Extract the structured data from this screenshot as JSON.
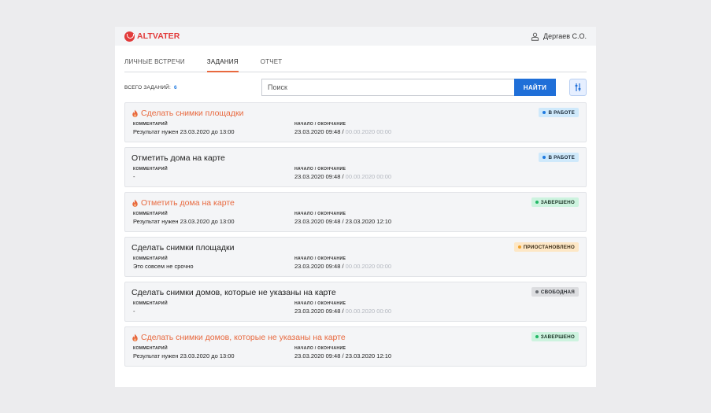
{
  "header": {
    "logo_text": "ALTVATER",
    "user_name": "Дергаев С.О."
  },
  "tabs": [
    {
      "label": "ЛИЧНЫЕ ВСТРЕЧИ",
      "active": false
    },
    {
      "label": "ЗАДАНИЯ",
      "active": true
    },
    {
      "label": "ОТЧЕТ",
      "active": false
    }
  ],
  "toolbar": {
    "total_label": "ВСЕГО ЗАДАНИЙ:",
    "total_count": "6",
    "search_placeholder": "Поиск",
    "search_button": "НАЙТИ"
  },
  "labels": {
    "comment": "КОММЕНТАРИЙ",
    "period": "НАЧАЛО / ОКОНЧАНИЕ"
  },
  "colors": {
    "accent": "#e8693f",
    "primary": "#1f6fd8",
    "brand": "#e23b3b"
  },
  "tasks": [
    {
      "title": "Сделать снимки площадки",
      "urgent": true,
      "status": "В РАБОТЕ",
      "status_kind": "work",
      "comment": "Результат нужен 23.03.2020 до 13:00",
      "start": "23.03.2020 09:48",
      "sep": " / ",
      "end": "00.00.2020 00:00",
      "end_set": false
    },
    {
      "title": "Отметить дома на карте",
      "urgent": false,
      "status": "В РАБОТЕ",
      "status_kind": "work",
      "comment": "-",
      "start": "23.03.2020 09:48",
      "sep": " / ",
      "end": "00.00.2020 00:00",
      "end_set": false
    },
    {
      "title": "Отметить дома на карте",
      "urgent": true,
      "status": "ЗАВЕРШЕНО",
      "status_kind": "done",
      "comment": "Результат нужен 23.03.2020 до 13:00",
      "start": "23.03.2020 09:48",
      "sep": " / ",
      "end": "23.03.2020 12:10",
      "end_set": true
    },
    {
      "title": "Сделать снимки площадки",
      "urgent": false,
      "status": "ПРИОСТАНОВЛЕНО",
      "status_kind": "paused",
      "comment": "Это совсем не срочно",
      "start": "23.03.2020 09:48",
      "sep": " / ",
      "end": "00.00.2020 00:00",
      "end_set": false
    },
    {
      "title": "Сделать снимки домов, которые не указаны на карте",
      "urgent": false,
      "status": "СВОБОДНАЯ",
      "status_kind": "free",
      "comment": "-",
      "start": "23.03.2020 09:48",
      "sep": " / ",
      "end": "00.00.2020 00:00",
      "end_set": false
    },
    {
      "title": "Сделать снимки домов, которые не указаны на карте",
      "urgent": true,
      "status": "ЗАВЕРШЕНО",
      "status_kind": "done",
      "comment": "Результат нужен 23.03.2020 до 13:00",
      "start": "23.03.2020 09:48",
      "sep": " / ",
      "end": "23.03.2020 12:10",
      "end_set": true
    }
  ]
}
